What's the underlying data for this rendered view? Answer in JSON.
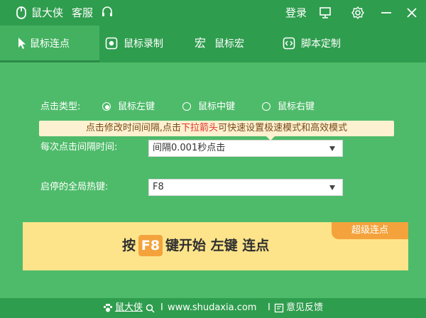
{
  "app": {
    "title": "鼠大侠",
    "support": "客服",
    "login": "登录"
  },
  "tabs": [
    {
      "label": "鼠标连点",
      "icon": "cursor-arrow-icon",
      "active": true
    },
    {
      "label": "鼠标录制",
      "icon": "record-icon",
      "active": false
    },
    {
      "label": "鼠标宏",
      "icon": "macro-icon",
      "active": false
    },
    {
      "label": "脚本定制",
      "icon": "script-icon",
      "active": false
    }
  ],
  "click_type": {
    "label": "点击类型:",
    "options": [
      {
        "label": "鼠标左键",
        "selected": true
      },
      {
        "label": "鼠标中键",
        "selected": false
      },
      {
        "label": "鼠标右键",
        "selected": false
      }
    ]
  },
  "tip": {
    "before": "点击修改时间间隔,点击",
    "highlight": "下拉箭头",
    "after": "可快速设置极速模式和高效模式"
  },
  "interval": {
    "label": "每次点击间隔时间:",
    "value": "间隔0.001秒点击"
  },
  "hotkey": {
    "label": "启停的全局热键:",
    "value": "F8"
  },
  "banner": {
    "badge": "超级连点",
    "prefix": "按",
    "key": "F8",
    "suffix": "键开始 左键 连点"
  },
  "footer": {
    "brand": "鼠大侠",
    "sep1": "I",
    "site": "www.shudaxia.com",
    "sep2": "I",
    "feedback": "意见反馈"
  },
  "colors": {
    "background": "#4ebb6a",
    "header": "#2f9d4e",
    "banner": "#fde48a",
    "accent": "#f4a33c",
    "tip_highlight": "#e0312a"
  }
}
